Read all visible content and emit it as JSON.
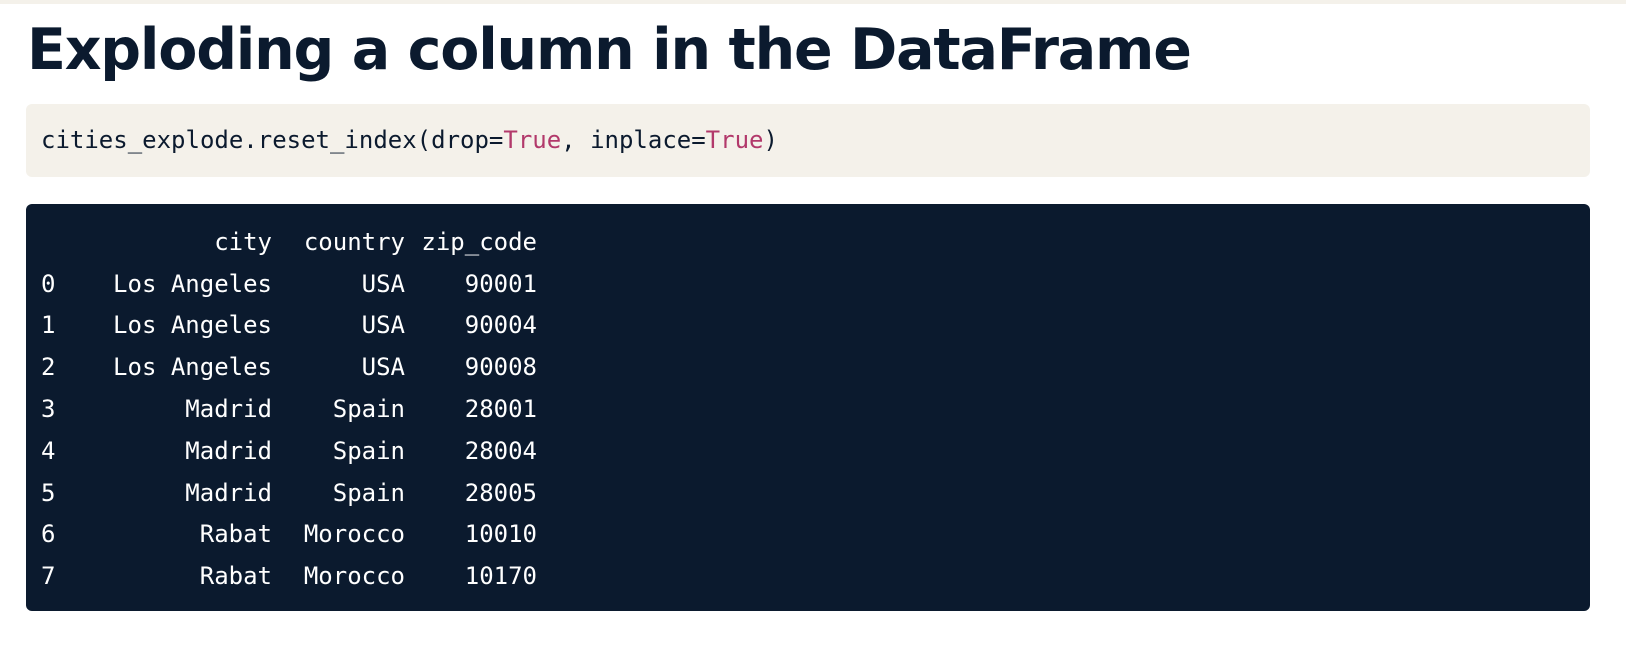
{
  "title": "Exploding a column in the DataFrame",
  "code": {
    "prefix": "cities_explode.reset_index(drop=",
    "kw1": "True",
    "middle": ", inplace=",
    "kw2": "True",
    "suffix": ")"
  },
  "output": {
    "header": {
      "index": "",
      "city": "city",
      "country": "country",
      "zip_code": "zip_code"
    },
    "rows": [
      {
        "index": "0",
        "city": "Los Angeles",
        "country": "USA",
        "zip_code": "90001"
      },
      {
        "index": "1",
        "city": "Los Angeles",
        "country": "USA",
        "zip_code": "90004"
      },
      {
        "index": "2",
        "city": "Los Angeles",
        "country": "USA",
        "zip_code": "90008"
      },
      {
        "index": "3",
        "city": "Madrid",
        "country": "Spain",
        "zip_code": "28001"
      },
      {
        "index": "4",
        "city": "Madrid",
        "country": "Spain",
        "zip_code": "28004"
      },
      {
        "index": "5",
        "city": "Madrid",
        "country": "Spain",
        "zip_code": "28005"
      },
      {
        "index": "6",
        "city": "Rabat",
        "country": "Morocco",
        "zip_code": "10010"
      },
      {
        "index": "7",
        "city": "Rabat",
        "country": "Morocco",
        "zip_code": "10170"
      }
    ]
  },
  "colors": {
    "title": "#0b1a2e",
    "code_background": "#f4f1ea",
    "keyword": "#b2396b",
    "output_background": "#0b1a2e",
    "output_text": "#ffffff"
  }
}
